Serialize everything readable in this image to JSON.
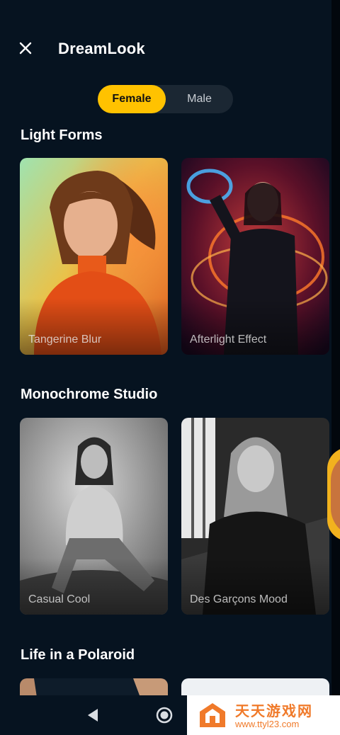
{
  "header": {
    "title": "DreamLook",
    "close_icon": "close-icon"
  },
  "gender_toggle": {
    "options": [
      "Female",
      "Male"
    ],
    "selected": "Female"
  },
  "sections": [
    {
      "title": "Light Forms",
      "cards": [
        "Tangerine Blur",
        "Afterlight Effect"
      ]
    },
    {
      "title": "Monochrome Studio",
      "cards": [
        "Casual Cool",
        "Des Garçons Mood"
      ]
    },
    {
      "title": "Life in a Polaroid",
      "cards": []
    }
  ],
  "colors": {
    "background": "#061320",
    "accent": "#ffc200",
    "toggle_bg": "#1b2733"
  },
  "nav": {
    "icons": [
      "back-icon",
      "home-icon"
    ]
  },
  "watermark": {
    "title": "天天游戏网",
    "url": "www.ttyl23.com"
  }
}
